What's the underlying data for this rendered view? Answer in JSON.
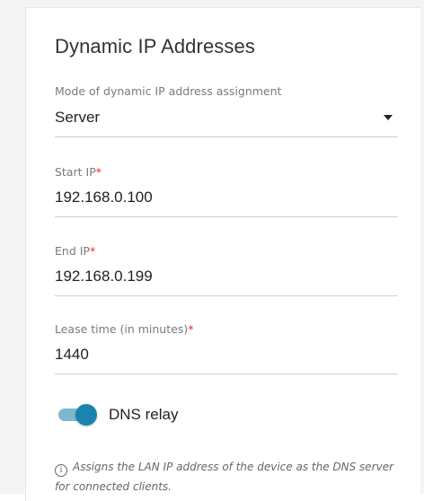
{
  "section": {
    "title": "Dynamic IP Addresses"
  },
  "mode": {
    "label": "Mode of dynamic IP address assignment",
    "value": "Server"
  },
  "start_ip": {
    "label": "Start IP",
    "required_mark": "*",
    "value": "192.168.0.100"
  },
  "end_ip": {
    "label": "End IP",
    "required_mark": "*",
    "value": "192.168.0.199"
  },
  "lease_time": {
    "label": "Lease time (in minutes)",
    "required_mark": "*",
    "value": "1440"
  },
  "dns_relay": {
    "label": "DNS relay",
    "enabled": true
  },
  "hint": {
    "icon": "info-icon",
    "text": "Assigns the LAN IP address of the device as the DNS server for connected clients."
  },
  "colors": {
    "accent": "#1a84ad",
    "accent_track": "#7fb7d0",
    "required": "#e52e2e"
  }
}
